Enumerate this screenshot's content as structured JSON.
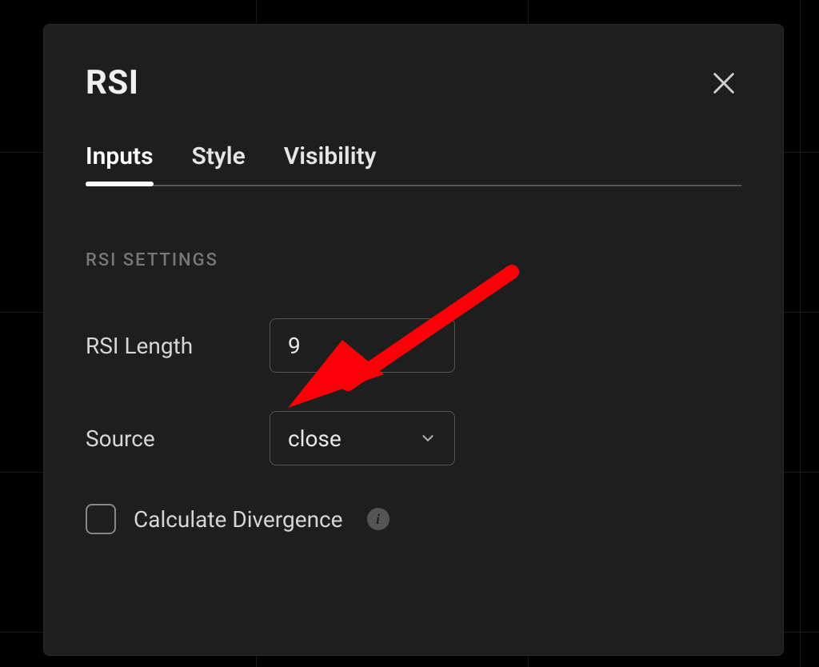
{
  "dialog": {
    "title": "RSI",
    "tabs": [
      {
        "label": "Inputs",
        "active": true
      },
      {
        "label": "Style",
        "active": false
      },
      {
        "label": "Visibility",
        "active": false
      }
    ],
    "section_label": "RSI SETTINGS",
    "rsi_length": {
      "label": "RSI Length",
      "value": "9"
    },
    "source": {
      "label": "Source",
      "value": "close"
    },
    "calc_divergence": {
      "label": "Calculate Divergence",
      "checked": false
    },
    "icons": {
      "close": "close-icon",
      "chevron": "chevron-down-icon",
      "info": "info-icon"
    },
    "colors": {
      "bg": "#1e1e1e",
      "text": "#d6d6d6",
      "border": "#555",
      "accent_arrow": "#fb0007"
    }
  }
}
